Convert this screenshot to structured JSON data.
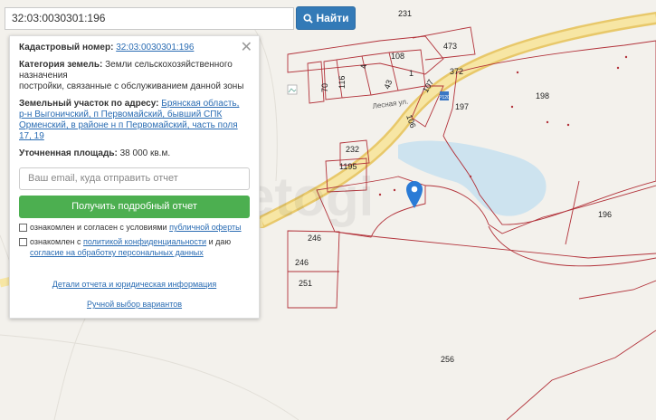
{
  "search": {
    "value": "32:03:0030301:196",
    "button_label": "Найти"
  },
  "panel": {
    "cadastral_label": "Кадастровый номер:",
    "cadastral_value": "32:03:0030301:196",
    "category_label": "Категория земель:",
    "category_value": "Земли сельскохозяйственного назначения",
    "category_extra": "постройки, связанные с обслуживанием данной зоны",
    "address_label": "Земельный участок по адресу:",
    "address_value": "Брянская область, р-н Выгоничский, п Первомайский, бывший СПК Орменский, в районе н п Первомайский, часть поля 17, 19",
    "area_label": "Уточненная площадь:",
    "area_value": "38 000 кв.м.",
    "email_placeholder": "Ваш email, куда отправить отчет",
    "report_button": "Получить подробный отчет",
    "consent1_prefix": "ознакомлен и согласен с условиями ",
    "consent1_link": "публичной оферты",
    "consent2_prefix": "ознакомлен с ",
    "consent2_link1": "политикой конфиденциальности",
    "consent2_mid": " и даю ",
    "consent2_link2": "согласие на обработку персональных данных",
    "details_link": "Детали отчета и юридическая информация",
    "manual_link": "Ручной выбор вариантов"
  },
  "map": {
    "watermark": "etogi",
    "road_label": "Лесная ул.",
    "shield_label": "Р120",
    "parcel_numbers": [
      "231",
      "473",
      "108",
      "372",
      "70",
      "116",
      "4",
      "43",
      "1",
      "107",
      "106",
      "198",
      "197",
      "232",
      "1195",
      "196",
      "246",
      "246",
      "251",
      "256"
    ]
  }
}
